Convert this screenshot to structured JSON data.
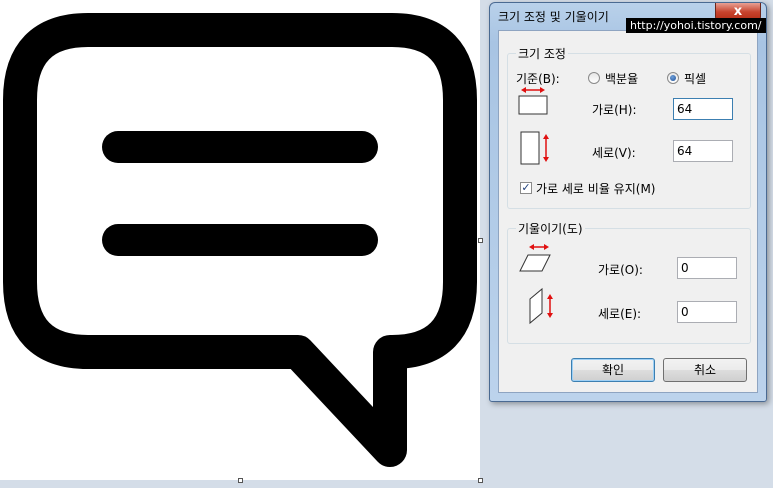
{
  "dialog": {
    "title": "크기 조정 및 기울이기",
    "close_label": "x"
  },
  "watermark": "http://yohoi.tistory.com/",
  "resize": {
    "group_title": "크기 조정",
    "basis_label": "기준(B):",
    "option_percent": "백분율",
    "option_pixel": "픽셀",
    "selected": "픽셀",
    "horizontal_label": "가로(H):",
    "horizontal_value": "64",
    "vertical_label": "세로(V):",
    "vertical_value": "64",
    "keep_ratio_label": "가로 세로 비율 유지(M)",
    "keep_ratio_checked": true
  },
  "skew": {
    "group_title": "기울이기(도)",
    "horizontal_label": "가로(O):",
    "horizontal_value": "0",
    "vertical_label": "세로(E):",
    "vertical_value": "0"
  },
  "buttons": {
    "ok": "확인",
    "cancel": "취소"
  },
  "colors": {
    "arrow": "#e01010",
    "icon_black": "#000000",
    "accent": "#3c7fb1"
  }
}
